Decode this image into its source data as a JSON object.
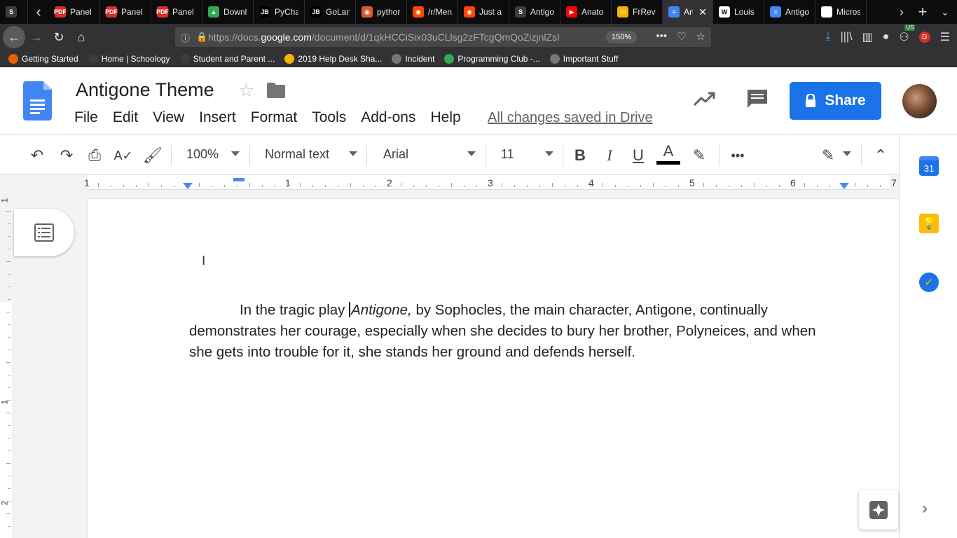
{
  "browser": {
    "tabs": [
      {
        "label": "",
        "favicon": "S",
        "color": "#3d3d3d"
      },
      {
        "label": "Panel",
        "favicon": "PDF",
        "color": "#d93025"
      },
      {
        "label": "Panel",
        "favicon": "PDF",
        "color": "#d93025"
      },
      {
        "label": "Panel",
        "favicon": "PDF",
        "color": "#d93025"
      },
      {
        "label": "Downl",
        "favicon": "drive",
        "color": "#34a853"
      },
      {
        "label": "PyCha",
        "favicon": "JB",
        "color": "#000000"
      },
      {
        "label": "GoLan",
        "favicon": "JB",
        "color": "#000000"
      },
      {
        "label": "pythor",
        "favicon": "duck",
        "color": "#de5833"
      },
      {
        "label": "/r/Men",
        "favicon": "reddit",
        "color": "#ff4500"
      },
      {
        "label": "Just a",
        "favicon": "reddit",
        "color": "#ff4500"
      },
      {
        "label": "Antigo",
        "favicon": "S",
        "color": "#3d3d3d"
      },
      {
        "label": "Anato",
        "favicon": "yt",
        "color": "#ff0000"
      },
      {
        "label": "FrRev",
        "favicon": "slides",
        "color": "#f4b400"
      },
      {
        "label": "Ant",
        "favicon": "docs",
        "color": "#4285f4",
        "active": true
      },
      {
        "label": "Louis",
        "favicon": "W",
        "color": "#ffffff"
      },
      {
        "label": "Antigo",
        "favicon": "docs",
        "color": "#4285f4"
      },
      {
        "label": "Micros",
        "favicon": "blank",
        "color": "#ffffff"
      }
    ],
    "url_prefix": "https://docs.",
    "url_domain": "google.com",
    "url_rest": "/document/d/1qkHCCiSix03uCLlsg2zFTcgQmQoZizjnlZsI",
    "zoom": "150%",
    "bookmarks": [
      {
        "label": "Getting Started",
        "color": "#e66000"
      },
      {
        "label": "Home | Schoology",
        "color": "#3d3d3d"
      },
      {
        "label": "Student and Parent ...",
        "color": "#3d3d3d"
      },
      {
        "label": "2019 Help Desk Sha...",
        "color": "#f4b400"
      },
      {
        "label": "Incident",
        "color": "#777777"
      },
      {
        "label": "Programming Club -...",
        "color": "#34a853"
      },
      {
        "label": "Important Stuff",
        "color": "#777777"
      }
    ],
    "badge_us": "US",
    "badge_d": "D"
  },
  "docs": {
    "title": "Antigone Theme",
    "menu": [
      "File",
      "Edit",
      "View",
      "Insert",
      "Format",
      "Tools",
      "Add-ons",
      "Help"
    ],
    "saved_status": "All changes saved in Drive",
    "share_label": "Share",
    "toolbar": {
      "zoom": "100%",
      "style": "Normal text",
      "font": "Arial",
      "size": "11"
    },
    "ruler_numbers": [
      "1",
      "1",
      "2",
      "3",
      "4",
      "5",
      "6",
      "7"
    ],
    "vruler_numbers": [
      "1",
      "1",
      "2"
    ],
    "paragraph": {
      "before": "In the tragic play ",
      "title": "Antigone,",
      "after": " by Sophocles, the main character, Antigone, continually demonstrates her courage, especially when she decides to bury her brother, Polyneices, and when she gets into trouble for it, she stands her ground and defends herself."
    },
    "calendar_day": "31"
  },
  "colors": {
    "accent": "#1a73e8",
    "keep": "#fbbc04",
    "tasks": "#1a73e8"
  }
}
